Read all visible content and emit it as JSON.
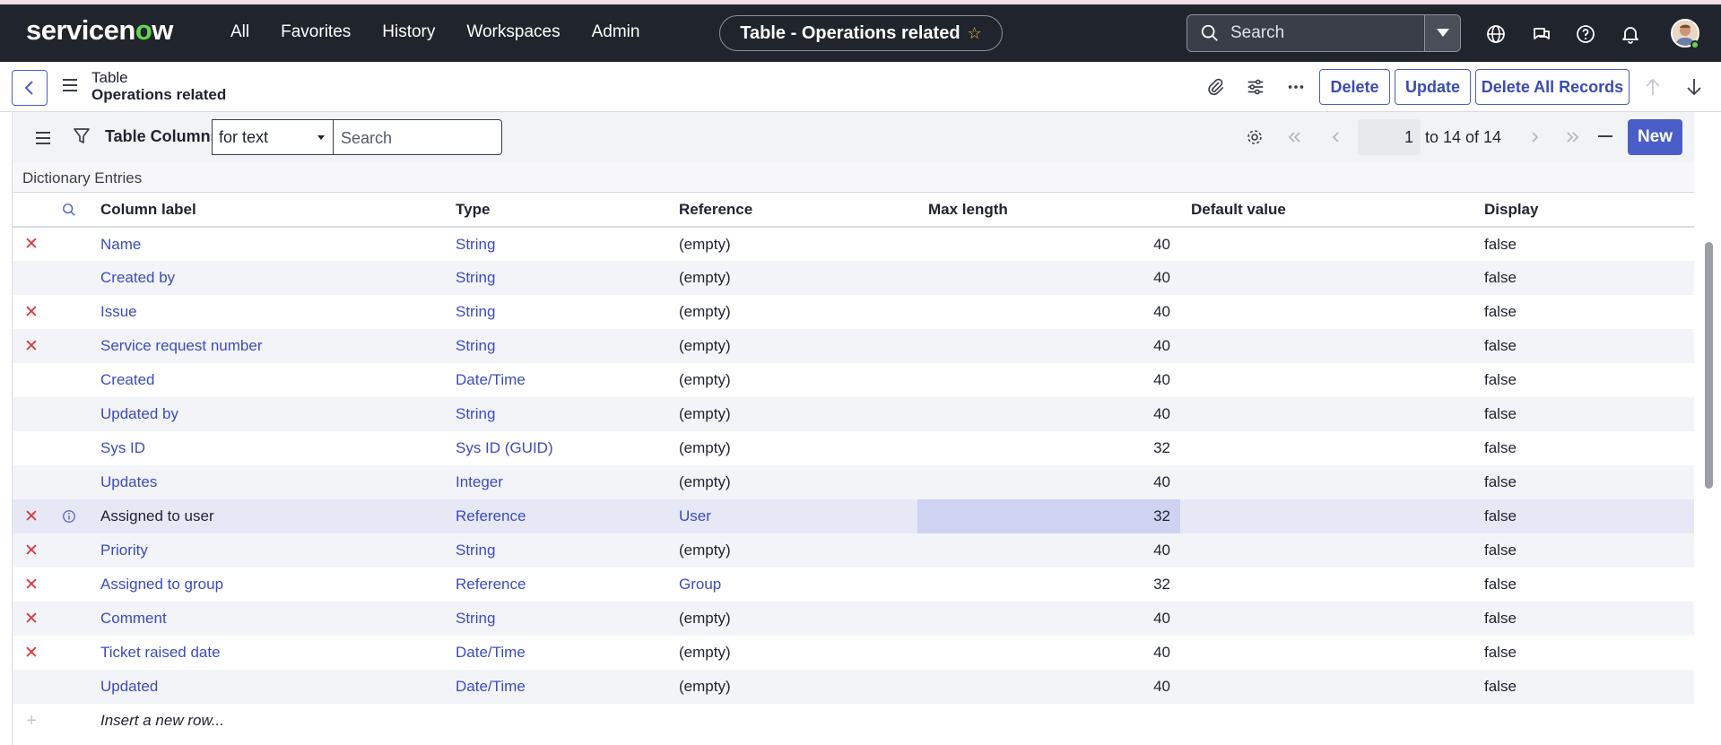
{
  "topnav": {
    "logo": "servicenow",
    "items": [
      "All",
      "Favorites",
      "History",
      "Workspaces",
      "Admin"
    ],
    "context_title": "Table - Operations related",
    "search_placeholder": "Search"
  },
  "record": {
    "title_line1": "Table",
    "title_line2": "Operations related",
    "buttons": {
      "delete": "Delete",
      "update": "Update",
      "delete_all": "Delete All Records"
    }
  },
  "related_list": {
    "title": "Table Columns",
    "filter_select": "for text",
    "search_placeholder": "Search",
    "page_current": "1",
    "page_range": "to 14 of 14",
    "new_button": "New",
    "group_label": "Dictionary Entries",
    "columns": [
      "Column label",
      "Type",
      "Reference",
      "Max length",
      "Default value",
      "Display"
    ],
    "rows": [
      {
        "deletable": true,
        "info": false,
        "label": "Name",
        "type": "String",
        "reference": "(empty)",
        "max_length": "40",
        "default": "",
        "display": "false",
        "label_link": true,
        "ref_link": false
      },
      {
        "deletable": false,
        "info": false,
        "label": "Created by",
        "type": "String",
        "reference": "(empty)",
        "max_length": "40",
        "default": "",
        "display": "false",
        "label_link": true,
        "ref_link": false
      },
      {
        "deletable": true,
        "info": false,
        "label": "Issue",
        "type": "String",
        "reference": "(empty)",
        "max_length": "40",
        "default": "",
        "display": "false",
        "label_link": true,
        "ref_link": false
      },
      {
        "deletable": true,
        "info": false,
        "label": "Service request number",
        "type": "String",
        "reference": "(empty)",
        "max_length": "40",
        "default": "",
        "display": "false",
        "label_link": true,
        "ref_link": false
      },
      {
        "deletable": false,
        "info": false,
        "label": "Created",
        "type": "Date/Time",
        "reference": "(empty)",
        "max_length": "40",
        "default": "",
        "display": "false",
        "label_link": true,
        "ref_link": false
      },
      {
        "deletable": false,
        "info": false,
        "label": "Updated by",
        "type": "String",
        "reference": "(empty)",
        "max_length": "40",
        "default": "",
        "display": "false",
        "label_link": true,
        "ref_link": false
      },
      {
        "deletable": false,
        "info": false,
        "label": "Sys ID",
        "type": "Sys ID (GUID)",
        "reference": "(empty)",
        "max_length": "32",
        "default": "",
        "display": "false",
        "label_link": true,
        "ref_link": false
      },
      {
        "deletable": false,
        "info": false,
        "label": "Updates",
        "type": "Integer",
        "reference": "(empty)",
        "max_length": "40",
        "default": "",
        "display": "false",
        "label_link": true,
        "ref_link": false
      },
      {
        "deletable": true,
        "info": true,
        "label": "Assigned to user",
        "type": "Reference",
        "reference": "User",
        "max_length": "32",
        "default": "",
        "display": "false",
        "label_link": false,
        "ref_link": true,
        "selected": true
      },
      {
        "deletable": true,
        "info": false,
        "label": "Priority",
        "type": "String",
        "reference": "(empty)",
        "max_length": "40",
        "default": "",
        "display": "false",
        "label_link": true,
        "ref_link": false
      },
      {
        "deletable": true,
        "info": false,
        "label": "Assigned to group",
        "type": "Reference",
        "reference": "Group",
        "max_length": "32",
        "default": "",
        "display": "false",
        "label_link": true,
        "ref_link": true
      },
      {
        "deletable": true,
        "info": false,
        "label": "Comment",
        "type": "String",
        "reference": "(empty)",
        "max_length": "40",
        "default": "",
        "display": "false",
        "label_link": true,
        "ref_link": false
      },
      {
        "deletable": true,
        "info": false,
        "label": "Ticket raised date",
        "type": "Date/Time",
        "reference": "(empty)",
        "max_length": "40",
        "default": "",
        "display": "false",
        "label_link": true,
        "ref_link": false
      },
      {
        "deletable": false,
        "info": false,
        "label": "Updated",
        "type": "Date/Time",
        "reference": "(empty)",
        "max_length": "40",
        "default": "",
        "display": "false",
        "label_link": true,
        "ref_link": false
      }
    ],
    "insert_row_label": "Insert a new row..."
  },
  "colors": {
    "nav_bg": "#20242d",
    "accent": "#4b5ec7",
    "link": "#3a4bc2",
    "delete_x": "#d83a3a",
    "logo_green": "#62d84e"
  }
}
